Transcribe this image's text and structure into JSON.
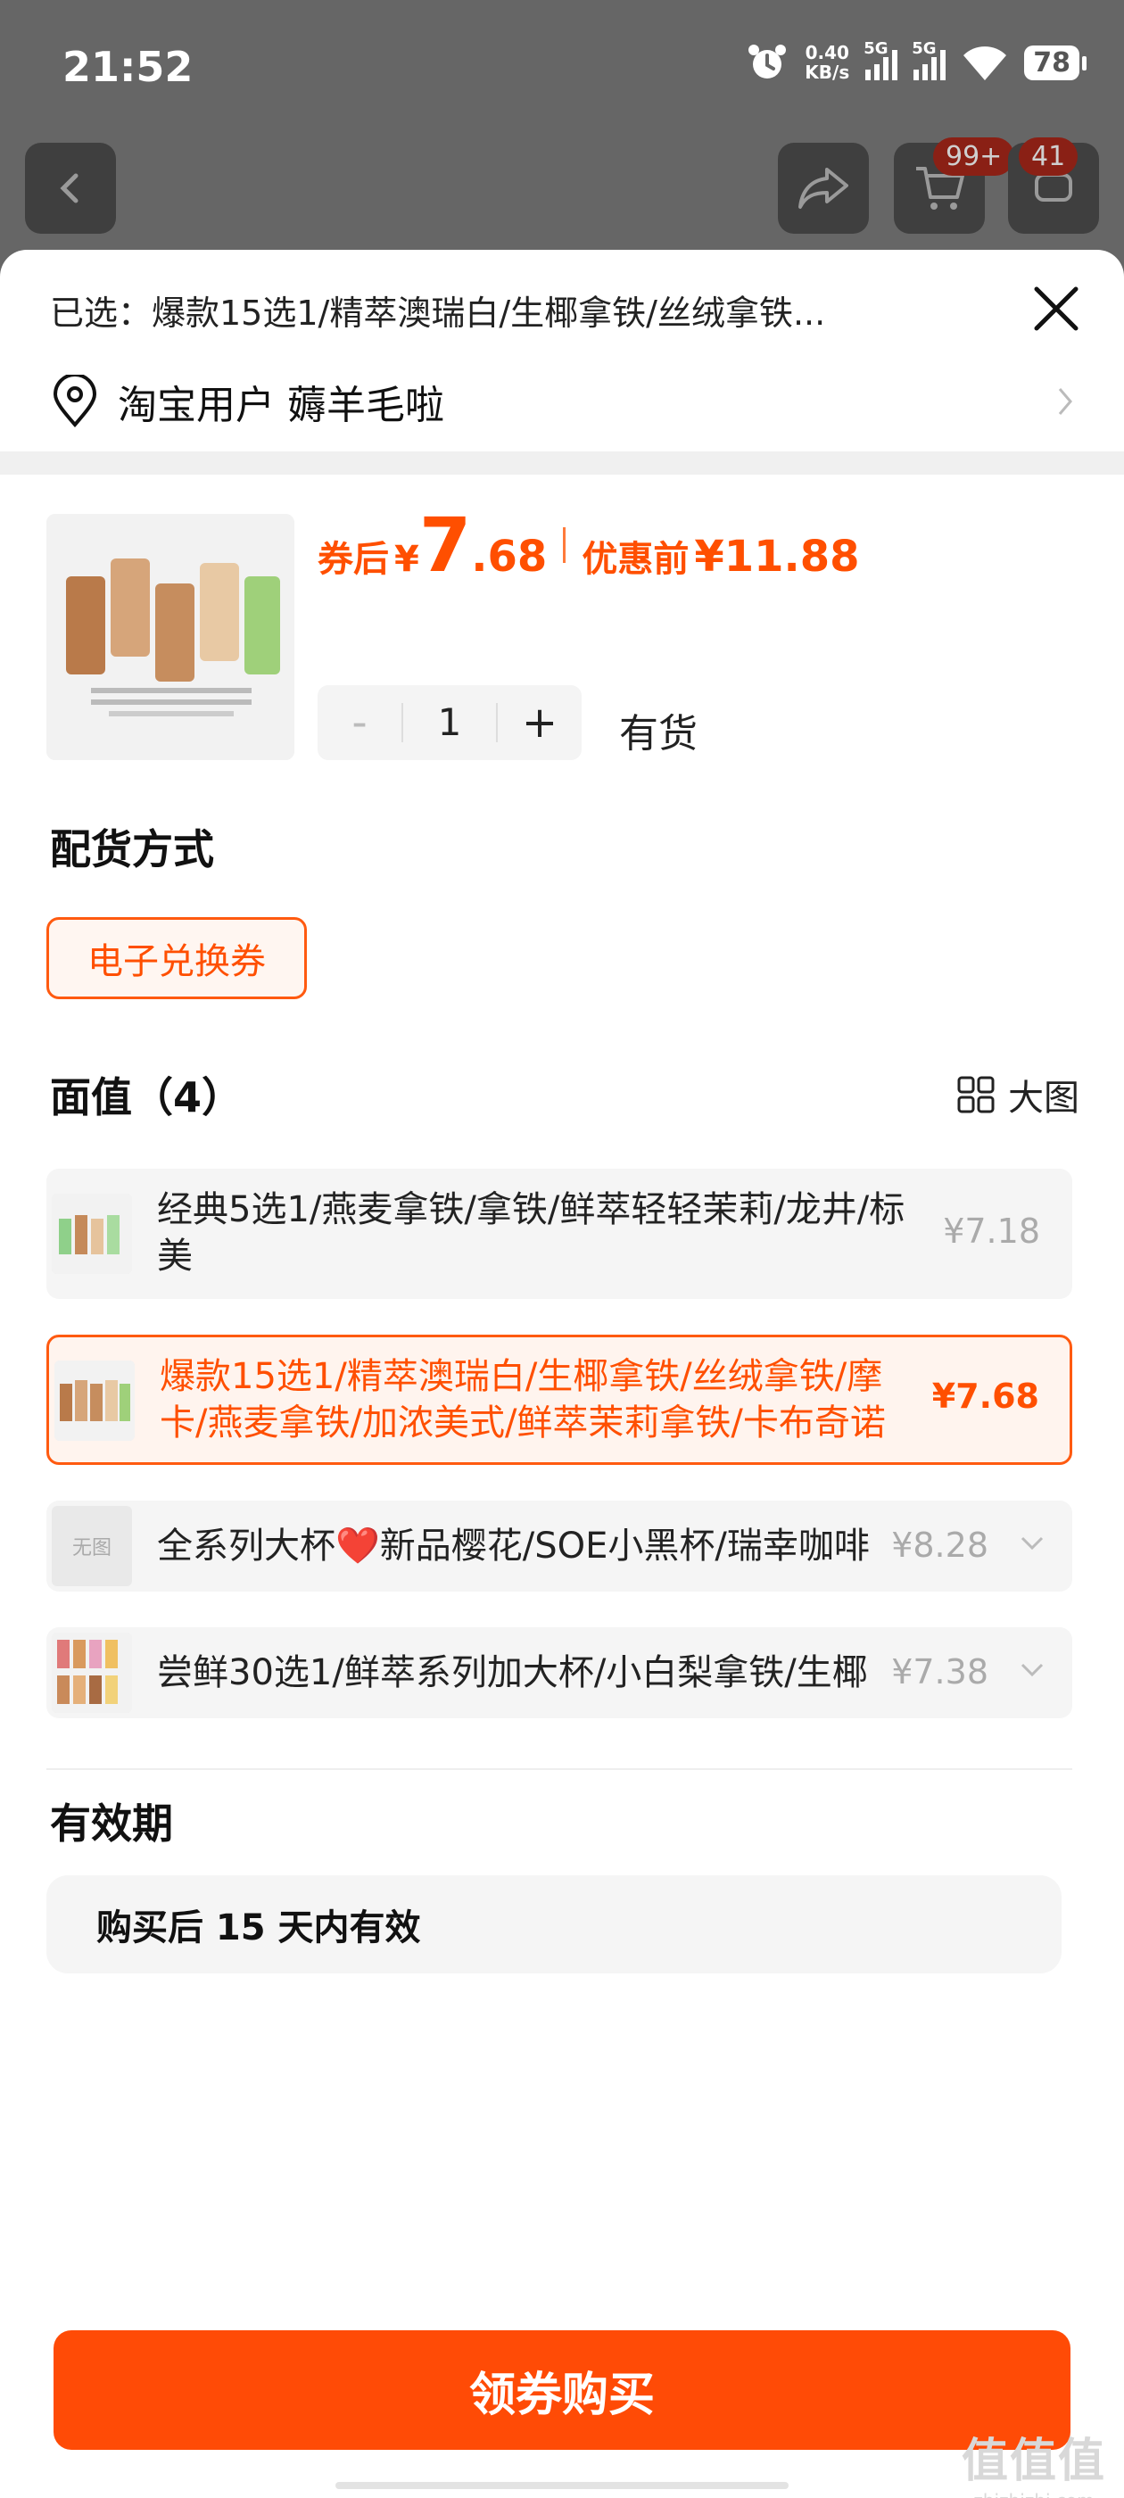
{
  "status": {
    "time": "21:52",
    "speed_value": "0.40",
    "speed_unit": "KB/s",
    "net1": "5G",
    "net2": "5G",
    "battery": "78"
  },
  "nav": {
    "cart_badge": "99+",
    "msg_badge": "41"
  },
  "sheet": {
    "selected_text": "已选：爆款15选1/精萃澳瑞白/生椰拿铁/丝绒拿铁...",
    "address": "淘宝用户 薅羊毛啦"
  },
  "product": {
    "coupon_label": "券后",
    "currency": "¥",
    "price_int": "7",
    "price_dec": ".68",
    "pre_label": "优惠前",
    "pre_price": "¥11.88",
    "quantity": "1",
    "minus": "-",
    "plus": "+",
    "stock": "有货"
  },
  "delivery": {
    "title": "配货方式",
    "option": "电子兑换券"
  },
  "denomination": {
    "title": "面值（4）",
    "bigview_label": "大图",
    "options": [
      {
        "text": "经典5选1/燕麦拿铁/拿铁/鲜萃轻轻茉莉/龙井/标美",
        "price": "¥7.18"
      },
      {
        "text": "爆款15选1/精萃澳瑞白/生椰拿铁/丝绒拿铁/摩卡/燕麦拿铁/加浓美式/鲜萃茉莉拿铁/卡布奇诺",
        "price": "¥7.68"
      },
      {
        "text": "全系列大杯❤️新品樱花/SOE小黑杯/瑞幸咖啡",
        "price": "¥8.28",
        "thumb_text": "无图"
      },
      {
        "text": "尝鲜30选1/鲜萃系列加大杯/小白梨拿铁/生椰",
        "price": "¥7.38"
      }
    ]
  },
  "validity": {
    "title": "有效期",
    "text": "购买后 15 天内有效"
  },
  "buy_button": "领券购买",
  "watermark": {
    "big": "值值值",
    "small": "zhizhizhi.com"
  }
}
